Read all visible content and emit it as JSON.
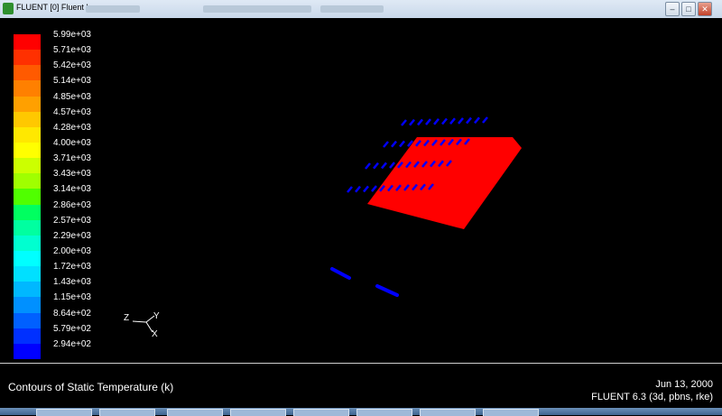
{
  "window": {
    "title": "FLUENT [0] Fluent Inc",
    "minimize_label": "–",
    "maximize_label": "□",
    "close_label": "✕"
  },
  "legend": {
    "labels": [
      "5.99e+03",
      "5.71e+03",
      "5.42e+03",
      "5.14e+03",
      "4.85e+03",
      "4.57e+03",
      "4.28e+03",
      "4.00e+03",
      "3.71e+03",
      "3.43e+03",
      "3.14e+03",
      "2.86e+03",
      "2.57e+03",
      "2.29e+03",
      "2.00e+03",
      "1.72e+03",
      "1.43e+03",
      "1.15e+03",
      "8.64e+02",
      "5.79e+02",
      "2.94e+02"
    ],
    "colors": [
      "#ff0000",
      "#ff3000",
      "#ff5a00",
      "#ff8000",
      "#ffa000",
      "#ffc800",
      "#ffe800",
      "#ffff00",
      "#ccff00",
      "#a0ff00",
      "#50ff00",
      "#00ff60",
      "#00ffa0",
      "#00ffd0",
      "#00ffff",
      "#00e0ff",
      "#00b8ff",
      "#0090ff",
      "#0060ff",
      "#0030ff",
      "#0000ff"
    ]
  },
  "axes": {
    "z": "Z",
    "y": "Y",
    "x": "X"
  },
  "footer": {
    "title": "Contours of Static Temperature (k)",
    "date": "Jun 13, 2000",
    "version": "FLUENT 6.3 (3d, pbns, rke)"
  },
  "scene_colors": {
    "hot": "#ff0000",
    "cold": "#0000ff"
  }
}
